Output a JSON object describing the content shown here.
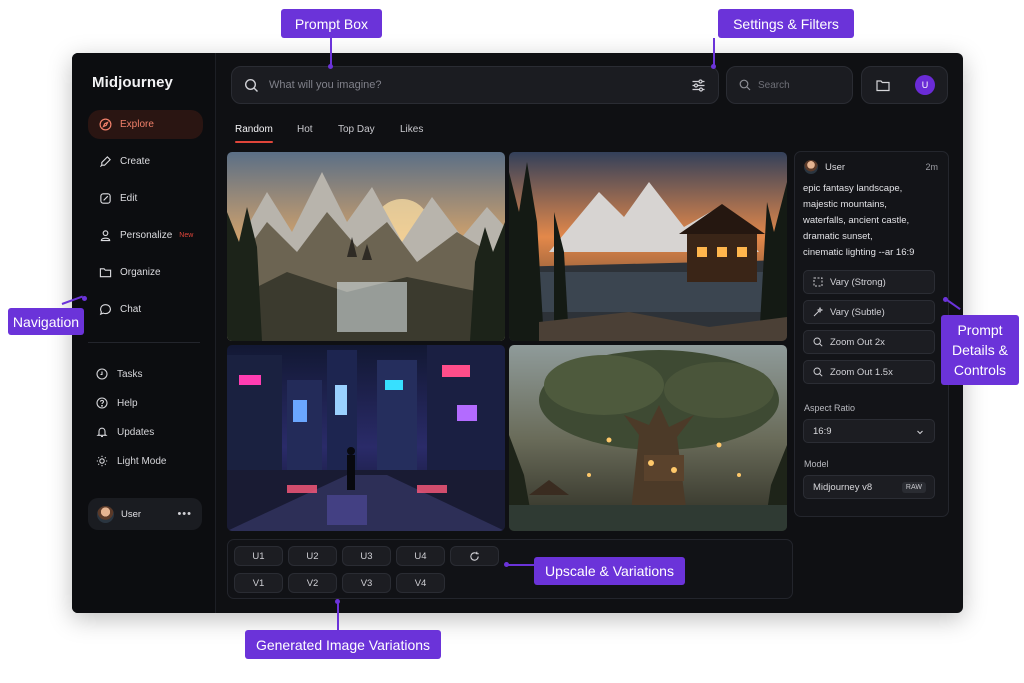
{
  "app": {
    "brand": "Midjourney"
  },
  "sidebar": {
    "nav": [
      {
        "label": "Explore",
        "icon": "compass-icon",
        "active": true
      },
      {
        "label": "Create",
        "icon": "brush-icon"
      },
      {
        "label": "Edit",
        "icon": "edit-icon"
      },
      {
        "label": "Personalize",
        "icon": "person-icon",
        "badge": "New"
      },
      {
        "label": "Organize",
        "icon": "folder-icon"
      },
      {
        "label": "Chat",
        "icon": "chat-bubble-icon"
      }
    ],
    "secondary": [
      {
        "label": "Tasks",
        "icon": "tasks-icon"
      },
      {
        "label": "Help",
        "icon": "help-icon"
      },
      {
        "label": "Updates",
        "icon": "bell-icon"
      },
      {
        "label": "Light Mode",
        "icon": "sun-icon"
      }
    ],
    "user": {
      "name": "User",
      "menu": "•••"
    }
  },
  "topbar": {
    "prompt_placeholder": "What will you imagine?",
    "search_placeholder": "Search",
    "user_initial": "U"
  },
  "tabs": [
    "Random",
    "Hot",
    "Top Day",
    "Likes"
  ],
  "gallery": {
    "images": [
      {
        "subject": "fantasy mountain landscape with waterfalls and castle at sunset"
      },
      {
        "subject": "log cabin by a lake with snowy mountains at sunset"
      },
      {
        "subject": "neon cyberpunk city street at night with figure"
      },
      {
        "subject": "giant ancient tree with treehouse village in misty forest"
      }
    ]
  },
  "actions": {
    "upscale": [
      "U1",
      "U2",
      "U3",
      "U4"
    ],
    "variations": [
      "V1",
      "V2",
      "V3",
      "V4"
    ],
    "reroll_icon": "refresh-icon"
  },
  "details": {
    "user": "User",
    "time": "2m",
    "prompt": "epic fantasy landscape,\nmajestic mountains,\nwaterfalls, ancient castle,\ndramatic sunset,\ncinematic lighting --ar 16:9",
    "controls": [
      {
        "label": "Vary (Strong)",
        "icon": "square-dashed-icon"
      },
      {
        "label": "Vary (Subtle)",
        "icon": "sparkle-icon"
      },
      {
        "label": "Zoom Out 2x",
        "icon": "zoom-icon"
      },
      {
        "label": "Zoom Out 1.5x",
        "icon": "zoom-icon"
      }
    ],
    "aspect_label": "Aspect Ratio",
    "aspect_value": "16:9",
    "model_label": "Model",
    "model_value": "Midjourney v8",
    "model_badge": "RAW"
  },
  "callouts": {
    "prompt_box": "Prompt Box",
    "settings": "Settings & Filters",
    "navigation": "Navigation",
    "details": "Prompt\nDetails &\nControls",
    "upscale": "Upscale & Variations",
    "generated": "Generated Image Variations"
  },
  "colors": {
    "accent": "#e0453a",
    "callout": "#6b33d9",
    "avatar": "#6a2bd6",
    "background": "#0f1013"
  }
}
